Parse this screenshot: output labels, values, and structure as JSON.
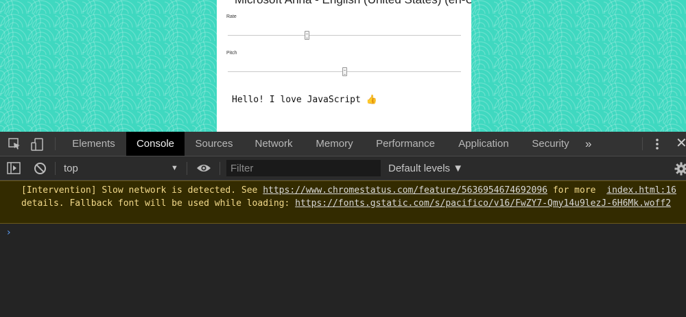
{
  "page": {
    "voice_select_value": "Microsoft Anna - English (United States) (en-US",
    "rate_label": "Rate",
    "rate_value": 0.34,
    "pitch_label": "Pitch",
    "pitch_value": 0.5,
    "text_to_speak": "Hello! I love JavaScript 👍"
  },
  "devtools": {
    "tabs": [
      {
        "label": "Elements",
        "active": false
      },
      {
        "label": "Console",
        "active": true
      },
      {
        "label": "Sources",
        "active": false
      },
      {
        "label": "Network",
        "active": false
      },
      {
        "label": "Memory",
        "active": false
      },
      {
        "label": "Performance",
        "active": false
      },
      {
        "label": "Application",
        "active": false
      },
      {
        "label": "Security",
        "active": false
      }
    ],
    "more_tabs_glyph": "»",
    "close_glyph": "✕",
    "console_toolbar": {
      "context": "top",
      "context_arrow": "▼",
      "filter_placeholder": "Filter",
      "levels": "Default levels ▼"
    },
    "message": {
      "prefix": "[Intervention] Slow network is detected. See ",
      "link1": "https://www.chromestatus.com/feature/5636954674692096",
      "middle": " for more details. Fallback font will be used while loading: ",
      "link2": "https://fonts.gstatic.com/s/pacifico/v16/FwZY7-Qmy14u9lezJ-6H6Mk.woff2",
      "source": "index.html:16"
    },
    "prompt_glyph": "›"
  },
  "colors": {
    "page_background": "#3fd8c0",
    "devtools_background": "#242424",
    "warning_background": "#332b00",
    "warning_text": "#f2d98a",
    "prompt": "#5a9cf5"
  }
}
